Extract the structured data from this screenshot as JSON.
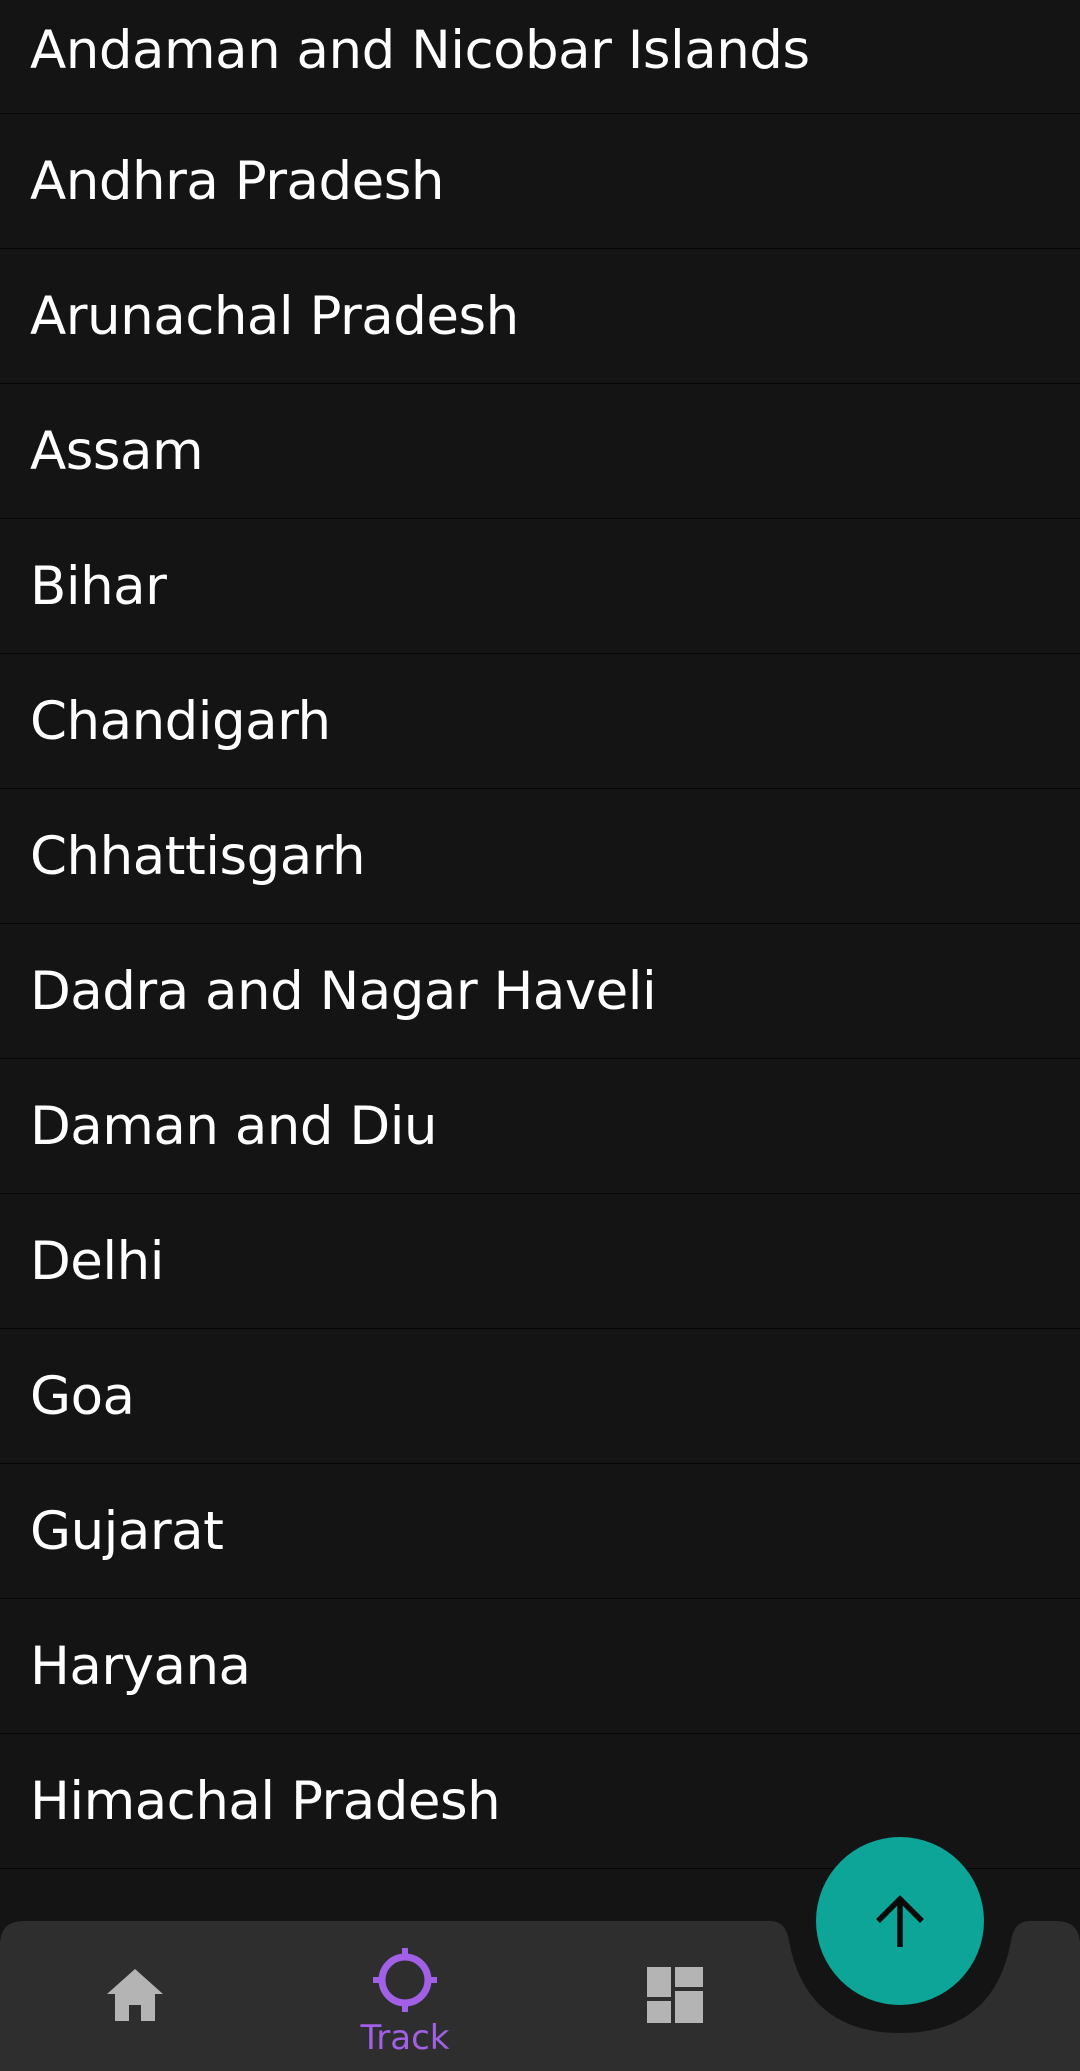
{
  "states": [
    "Andaman and Nicobar Islands",
    "Andhra Pradesh",
    "Arunachal Pradesh",
    "Assam",
    "Bihar",
    "Chandigarh",
    "Chhattisgarh",
    "Dadra and Nagar Haveli",
    "Daman and Diu",
    "Delhi",
    "Goa",
    "Gujarat",
    "Haryana",
    "Himachal Pradesh"
  ],
  "bottom_nav": {
    "items": [
      {
        "id": "home",
        "label": "",
        "icon": "home-icon",
        "active": false
      },
      {
        "id": "track",
        "label": "Track",
        "icon": "crosshair-icon",
        "active": true
      },
      {
        "id": "dashboard",
        "label": "",
        "icon": "dashboard-icon",
        "active": false
      }
    ],
    "active_color": "#a160e6",
    "inactive_color": "#b4b4b4",
    "background": "#2e2e2e"
  },
  "fab": {
    "icon": "arrow-up-icon",
    "color": "#0ca597"
  }
}
